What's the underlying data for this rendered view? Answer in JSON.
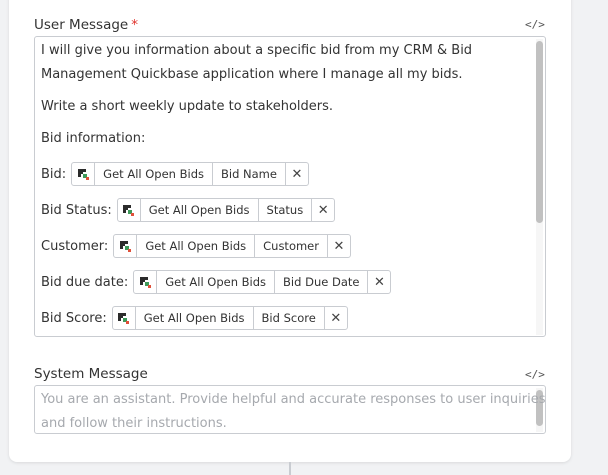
{
  "user_message": {
    "label": "User Message",
    "required_mark": "*",
    "code_toggle": "</>",
    "lines": [
      "I will give you information about a specific bid from my CRM & Bid",
      "Management Quickbase application where I manage all my bids.",
      "Write a short weekly update to stakeholders.",
      "Bid information:"
    ],
    "fields": [
      {
        "label": "Bid:",
        "source": "Get All Open Bids",
        "field": "Bid Name"
      },
      {
        "label": "Bid Status:",
        "source": "Get All Open Bids",
        "field": "Status"
      },
      {
        "label": "Customer:",
        "source": "Get All Open Bids",
        "field": "Customer"
      },
      {
        "label": "Bid due date:",
        "source": "Get All Open Bids",
        "field": "Bid Due Date"
      },
      {
        "label": "Bid Score:",
        "source": "Get All Open Bids",
        "field": "Bid Score"
      }
    ],
    "remove_glyph": "✕",
    "chip_icon": "quickbase-logo-icon"
  },
  "system_message": {
    "label": "System Message",
    "code_toggle": "</>",
    "placeholder_lines": [
      "You are an assistant. Provide helpful and accurate responses to user inquiries",
      "and follow their instructions."
    ]
  },
  "colors": {
    "required": "#e0322b",
    "placeholder": "#a6a9ae",
    "border": "#c9ccd1",
    "logo_dark": "#2b2b2b",
    "logo_green": "#3e9a5a",
    "logo_red": "#e0503a"
  }
}
